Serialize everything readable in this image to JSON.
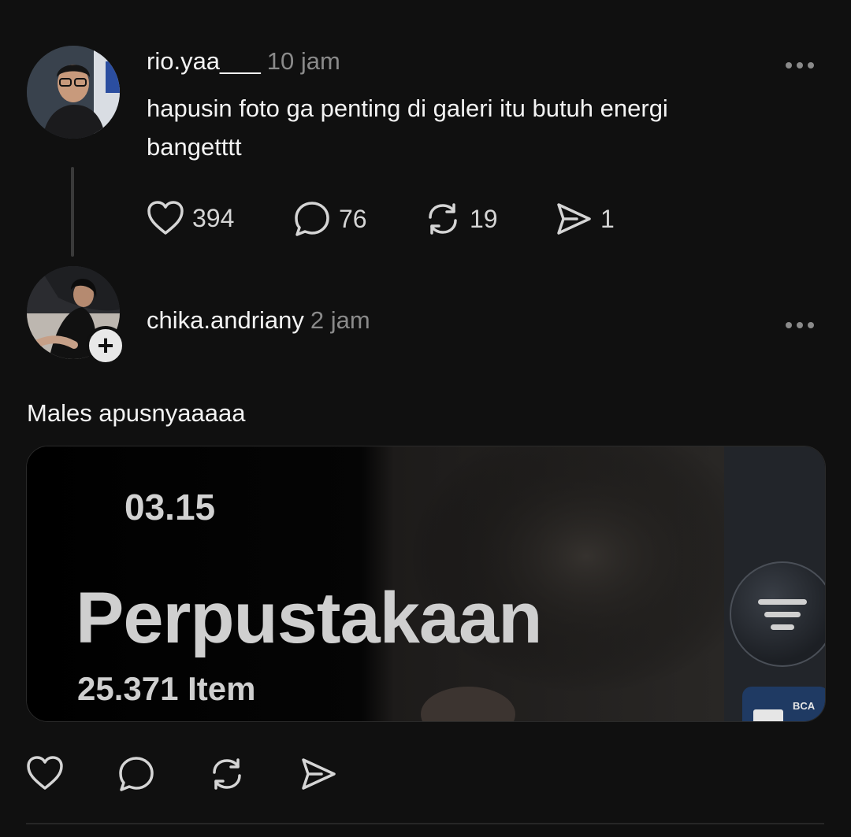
{
  "post1": {
    "username": "rio.yaa___",
    "time": "10 jam",
    "text": "hapusin foto ga penting di galeri itu butuh energi bangetttt",
    "actions": {
      "likes": "394",
      "comments": "76",
      "reposts": "19",
      "shares": "1"
    }
  },
  "post2": {
    "username": "chika.andriany",
    "time": "2 jam",
    "text": "Males apusnyaaaaa",
    "media": {
      "date": "03.15",
      "title": "Perpustakaan",
      "count": "25.371 Item",
      "badge": "BCA"
    }
  },
  "icons": [
    "heart-icon",
    "comment-icon",
    "repost-icon",
    "share-icon",
    "more-icon",
    "follow-plus-icon",
    "filter-icon"
  ],
  "colors": {
    "background": "#101010",
    "text": "#f3f3f3",
    "muted": "#8a8a8a"
  }
}
